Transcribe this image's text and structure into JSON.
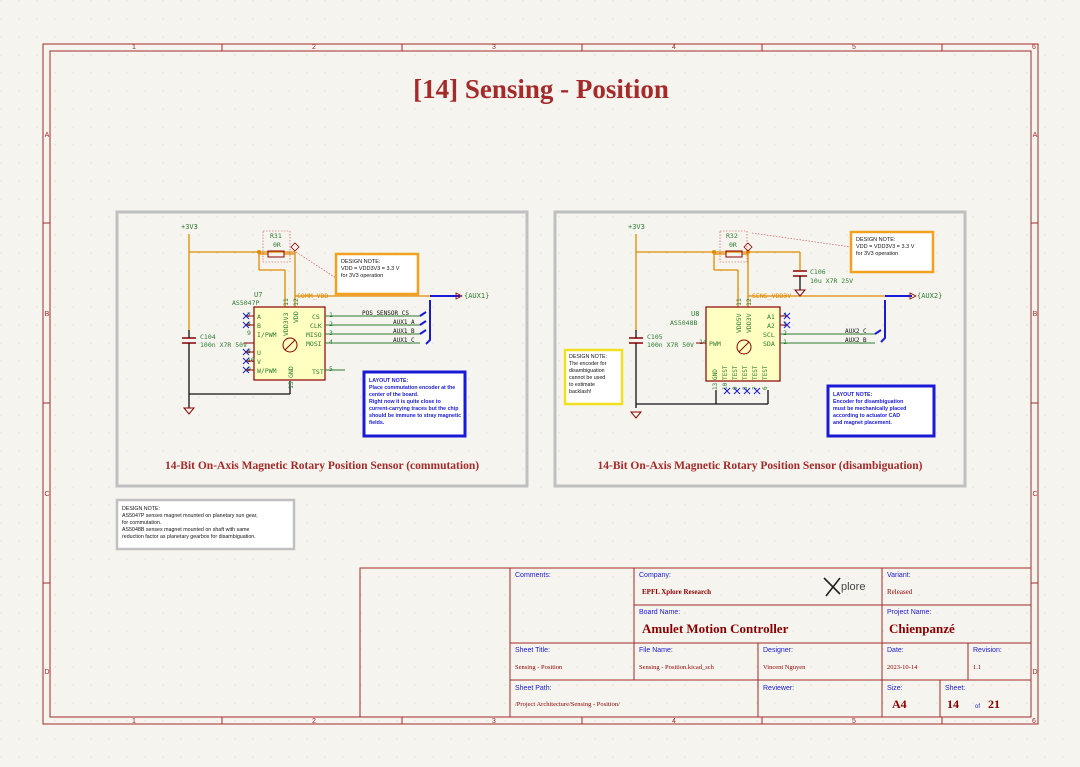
{
  "sheet": {
    "title": "[14] Sensing - Position",
    "col_labels": [
      "1",
      "2",
      "3",
      "4",
      "5",
      "6"
    ],
    "row_labels": [
      "A",
      "B",
      "C",
      "D"
    ]
  },
  "colors": {
    "border": "#a52a2a",
    "wire": "#2e7d32",
    "power": "#e08a00",
    "symbol": "#8b0000",
    "chip_fill": "#ffffc2",
    "group_border": "#c0c0c0",
    "note_orange": "#f2a11f",
    "note_blue": "#1a1ad6",
    "note_yellow": "#f0e020"
  },
  "left_block": {
    "power_label": "+3V3",
    "resistor_ref": "R31",
    "resistor_val": "0R",
    "net_vdd": "COMM_VDD",
    "cap_ref": "C104",
    "cap_val": "100n X7R 50V",
    "chip_ref": "U7",
    "chip_part": "AS5047P",
    "pin_left": [
      "A",
      "B",
      "I/PWM",
      "U",
      "V",
      "W/PWM"
    ],
    "pin_left_nums": [
      "7",
      "8",
      "9",
      "8",
      "10",
      "9"
    ],
    "pin_right": [
      "CS",
      "CLK",
      "MISO",
      "MOSI",
      "TST"
    ],
    "pin_right_nums": [
      "1",
      "2",
      "3",
      "4",
      "5"
    ],
    "pin_top": [
      "VDD3V3",
      "VDD"
    ],
    "pin_top_nums": [
      "11",
      "12"
    ],
    "pin_gnd": "GND",
    "pin_gnd_num": "13",
    "nets": [
      "POS_SENSOR_CS",
      "AUX1_A",
      "AUX1_B",
      "AUX1_C"
    ],
    "bus_label": "{AUX1}",
    "caption": "14-Bit On-Axis Magnetic Rotary Position Sensor (commutation)",
    "note_design": [
      "DESIGN NOTE:",
      "VDD = VDD3V3 = 3.3 V",
      "for 3V3 operation"
    ],
    "note_layout": [
      "LAYOUT NOTE:",
      "Place commutation encoder at the",
      "center of the board.",
      "Right now it is quite close to",
      "current-carrying traces but the chip",
      "should be immune to stray magnetic",
      "fields."
    ]
  },
  "right_block": {
    "power_label": "+3V3",
    "resistor_ref": "R32",
    "resistor_val": "0R",
    "net_vdd": "SENS_VDD3V",
    "cap_ref": "C105",
    "cap_val": "100n X7R 50V",
    "cap2_ref": "C106",
    "cap2_val": "10u X7R 25V",
    "chip_ref": "U8",
    "chip_part": "AS5048B",
    "pin_top": [
      "VDD5V",
      "VDD3V"
    ],
    "pin_top_nums": [
      "11",
      "12"
    ],
    "pin_right": [
      "A1",
      "A2",
      "SCL",
      "SDA"
    ],
    "pin_right_nums": [
      "4",
      "3",
      "2",
      "1"
    ],
    "pin_left": "PWM",
    "pin_left_num": "14",
    "pin_bottom": [
      "GND",
      "TEST",
      "TEST",
      "TEST",
      "TEST",
      "TEST"
    ],
    "pin_bottom_nums": [
      "13",
      "10",
      "9",
      "8",
      "7",
      "6"
    ],
    "nets": [
      "AUX2_C",
      "AUX2_B"
    ],
    "bus_label": "{AUX2}",
    "caption": "14-Bit On-Axis Magnetic Rotary Position Sensor (disambiguation)",
    "note_design": [
      "DESIGN NOTE:",
      "VDD = VDD3V3 = 3.3 V",
      "for 3V3 operation"
    ],
    "note_encoder": [
      "DESIGN NOTE:",
      "The encoder for",
      "disambiguation",
      "cannot be used",
      "to estimate",
      "backlash!"
    ],
    "note_layout": [
      "LAYOUT NOTE:",
      "Encoder for disambiguation",
      "must be mechanically placed",
      "according to actuator CAD",
      "and magnet placement."
    ]
  },
  "bottom_note": [
    "DESIGN NOTE:",
    "AS5047P senses magnet mounted on planetary sun gear,",
    "for commutation.",
    "AS5048B senses magnet mounted on shaft with same",
    "reduction factor as planetary gearbox for disambiguation."
  ],
  "title_block": {
    "comments_label": "Comments:",
    "company_label": "Company:",
    "company": "EPFL Xplore Research",
    "logo_text": "plore",
    "variant_label": "Variant:",
    "variant": "Released",
    "board_label": "Board Name:",
    "board": "Amulet Motion Controller",
    "project_label": "Project Name:",
    "project": "Chienpanzé",
    "sheet_title_label": "Sheet Title:",
    "sheet_title": "Sensing - Position",
    "file_label": "File Name:",
    "file": "Sensing - Position.kicad_sch",
    "designer_label": "Designer:",
    "designer": "Vincent Nguyen",
    "date_label": "Date:",
    "date": "2023-10-14",
    "revision_label": "Revision:",
    "revision": "1.1",
    "path_label": "Sheet Path:",
    "path": "/Project Architecture/Sensing - Position/",
    "reviewer_label": "Reviewer:",
    "size_label": "Size:",
    "size": "A4",
    "sheet_label": "Sheet:",
    "sheet_num": "14",
    "of_label": "of",
    "sheet_total": "21"
  }
}
